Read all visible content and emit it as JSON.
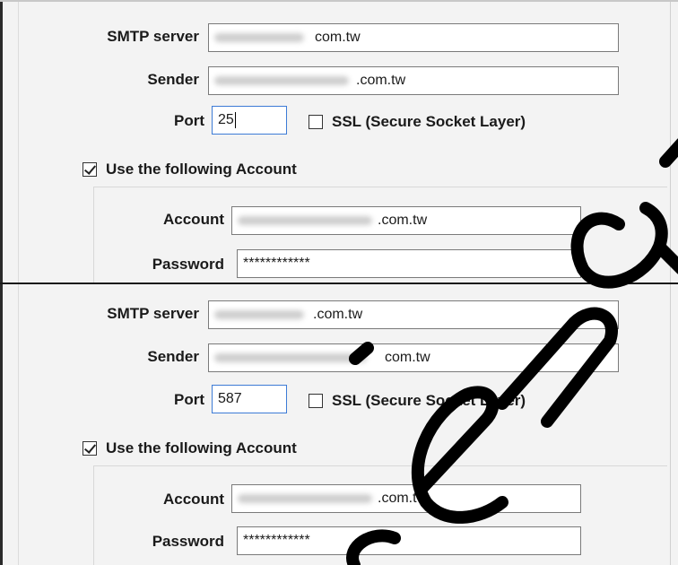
{
  "panels": [
    {
      "smtp_label": "SMTP server",
      "smtp_value": "com.tw",
      "sender_label": "Sender",
      "sender_value": ".com.tw",
      "port_label": "Port",
      "port_value": "25",
      "ssl_label": "SSL (Secure Socket Layer)",
      "use_account_label": "Use the following Account",
      "account_label": "Account",
      "account_value": ".com.tw",
      "password_label": "Password",
      "password_value": "************"
    },
    {
      "smtp_label": "SMTP server",
      "smtp_value": ".com.tw",
      "sender_label": "Sender",
      "sender_value": "com.tw",
      "port_label": "Port",
      "port_value": "587",
      "ssl_label": "SSL (Secure Socket Layer)",
      "use_account_label": "Use the following Account",
      "account_label": "Account",
      "account_value": ".com.tw",
      "password_label": "Password",
      "password_value": "************"
    }
  ],
  "colors": {
    "background": "#f3f3f3",
    "field_border": "#7a7a7a",
    "focus_border": "#3d7bd6",
    "watermark": "#000000"
  }
}
